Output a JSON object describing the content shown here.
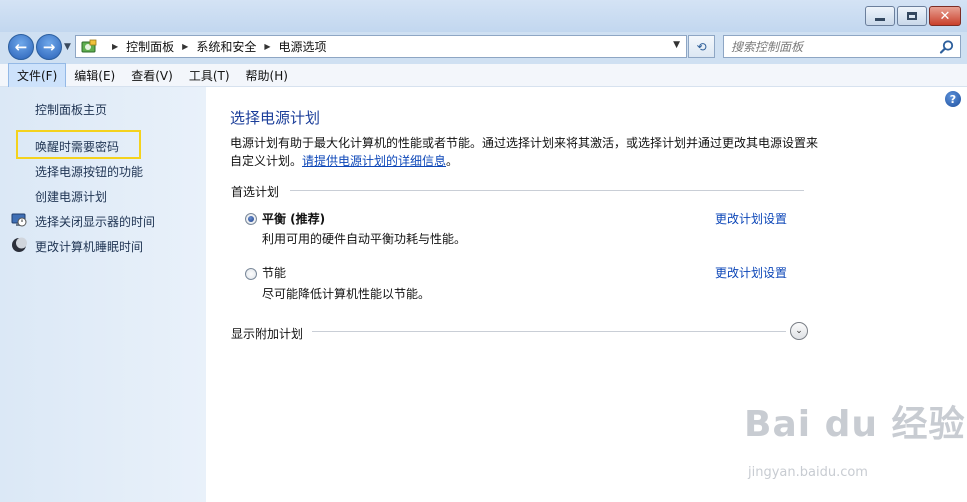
{
  "window": {
    "minimize_icon": "minimize-icon",
    "maximize_icon": "maximize-icon",
    "close_label": "✕"
  },
  "nav": {
    "back_glyph": "←",
    "forward_glyph": "→",
    "breadcrumbs": [
      "控制面板",
      "系统和安全",
      "电源选项"
    ],
    "refresh_glyph": "⟲",
    "search_placeholder": "搜索控制面板"
  },
  "menubar": {
    "items": [
      "文件(F)",
      "编辑(E)",
      "查看(V)",
      "工具(T)",
      "帮助(H)"
    ]
  },
  "sidebar": {
    "home": "控制面板主页",
    "links": [
      "唤醒时需要密码",
      "选择电源按钮的功能",
      "创建电源计划",
      "选择关闭显示器的时间",
      "更改计算机睡眠时间"
    ]
  },
  "main": {
    "help": "?",
    "title": "选择电源计划",
    "desc_text": "电源计划有助于最大化计算机的性能或者节能。通过选择计划来将其激活，或选择计划并通过更改其电源设置来自定义计划。",
    "desc_link": "请提供电源计划的详细信息",
    "desc_end": "。",
    "preferred_heading": "首选计划",
    "plans": [
      {
        "name": "平衡 (推荐)",
        "desc": "利用可用的硬件自动平衡功耗与性能。",
        "link": "更改计划设置",
        "selected": true
      },
      {
        "name": "节能",
        "desc": "尽可能降低计算机性能以节能。",
        "link": "更改计划设置",
        "selected": false
      }
    ],
    "additional_heading": "显示附加计划",
    "expander_glyph": "⌄"
  },
  "watermark": {
    "logo": "Bai du 经验",
    "url": "jingyan.baidu.com"
  }
}
